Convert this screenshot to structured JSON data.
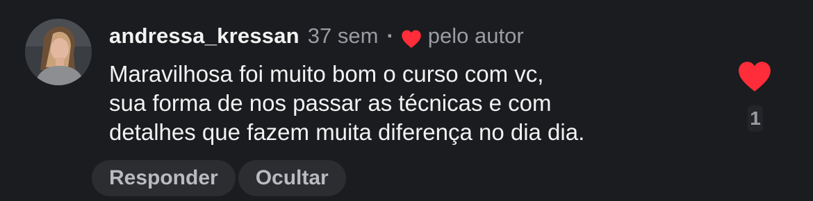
{
  "comment": {
    "username": "andressa_kressan",
    "time": "37 sem",
    "separator": "·",
    "liked_by_author_label": "pelo autor",
    "text_lines": [
      "Maravilhosa foi muito bom o curso com vc,",
      "sua forma de nos passar as técnicas e com",
      "detalhes que fazem muita diferença no dia dia."
    ],
    "like_count": "1",
    "actions": {
      "reply_label": "Responder",
      "hide_label": "Ocultar"
    }
  },
  "icons": {
    "author_heart": "heart-icon",
    "like": "heart-icon"
  },
  "colors": {
    "background": "#1a1c1f",
    "heart": "#ff2d3a",
    "text_primary": "#f2f2f2",
    "text_secondary": "#9a9ca3",
    "pill_background": "#2b2d31"
  }
}
